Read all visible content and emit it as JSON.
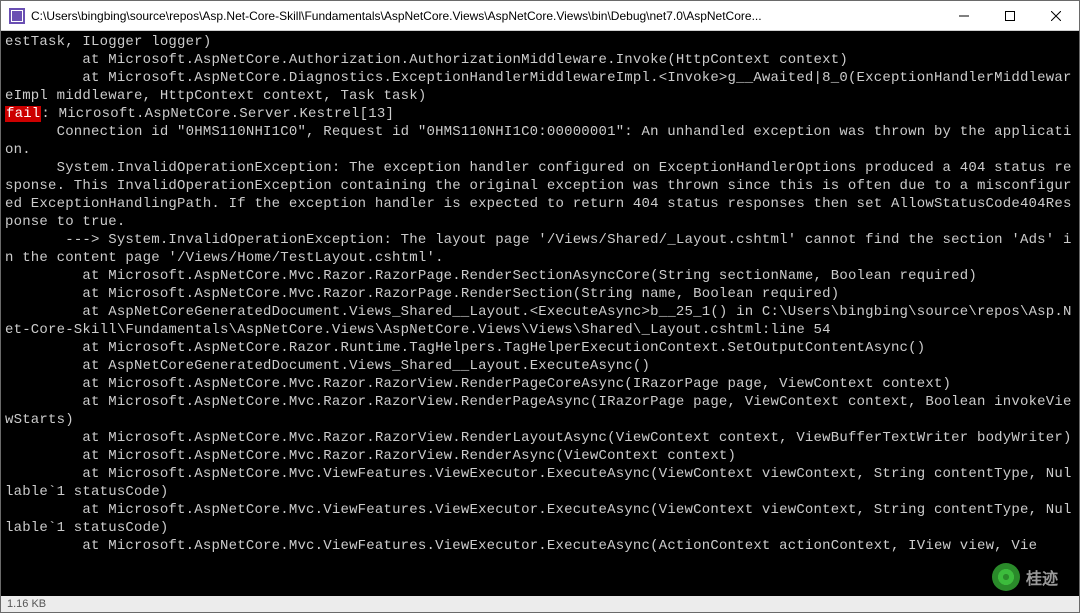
{
  "window": {
    "title": "C:\\Users\\bingbing\\source\\repos\\Asp.Net-Core-Skill\\Fundamentals\\AspNetCore.Views\\AspNetCore.Views\\bin\\Debug\\net7.0\\AspNetCore..."
  },
  "console": {
    "lines": [
      "estTask, ILogger logger)",
      "         at Microsoft.AspNetCore.Authorization.AuthorizationMiddleware.Invoke(HttpContext context)",
      "         at Microsoft.AspNetCore.Diagnostics.ExceptionHandlerMiddlewareImpl.<Invoke>g__Awaited|8_0(ExceptionHandlerMiddlewareImpl middleware, HttpContext context, Task task)"
    ],
    "fail_prefix": "fail",
    "fail_line": ": Microsoft.AspNetCore.Server.Kestrel[13]",
    "lines2": [
      "      Connection id \"0HMS110NHI1C0\", Request id \"0HMS110NHI1C0:00000001\": An unhandled exception was thrown by the application.",
      "      System.InvalidOperationException: The exception handler configured on ExceptionHandlerOptions produced a 404 status response. This InvalidOperationException containing the original exception was thrown since this is often due to a misconfigured ExceptionHandlingPath. If the exception handler is expected to return 404 status responses then set AllowStatusCode404Response to true.",
      "       ---> System.InvalidOperationException: The layout page '/Views/Shared/_Layout.cshtml' cannot find the section 'Ads' in the content page '/Views/Home/TestLayout.cshtml'.",
      "         at Microsoft.AspNetCore.Mvc.Razor.RazorPage.RenderSectionAsyncCore(String sectionName, Boolean required)",
      "         at Microsoft.AspNetCore.Mvc.Razor.RazorPage.RenderSection(String name, Boolean required)",
      "         at AspNetCoreGeneratedDocument.Views_Shared__Layout.<ExecuteAsync>b__25_1() in C:\\Users\\bingbing\\source\\repos\\Asp.Net-Core-Skill\\Fundamentals\\AspNetCore.Views\\AspNetCore.Views\\Views\\Shared\\_Layout.cshtml:line 54",
      "         at Microsoft.AspNetCore.Razor.Runtime.TagHelpers.TagHelperExecutionContext.SetOutputContentAsync()",
      "         at AspNetCoreGeneratedDocument.Views_Shared__Layout.ExecuteAsync()",
      "         at Microsoft.AspNetCore.Mvc.Razor.RazorView.RenderPageCoreAsync(IRazorPage page, ViewContext context)",
      "         at Microsoft.AspNetCore.Mvc.Razor.RazorView.RenderPageAsync(IRazorPage page, ViewContext context, Boolean invokeViewStarts)",
      "         at Microsoft.AspNetCore.Mvc.Razor.RazorView.RenderLayoutAsync(ViewContext context, ViewBufferTextWriter bodyWriter)",
      "         at Microsoft.AspNetCore.Mvc.Razor.RazorView.RenderAsync(ViewContext context)",
      "         at Microsoft.AspNetCore.Mvc.ViewFeatures.ViewExecutor.ExecuteAsync(ViewContext viewContext, String contentType, Nullable`1 statusCode)",
      "         at Microsoft.AspNetCore.Mvc.ViewFeatures.ViewExecutor.ExecuteAsync(ViewContext viewContext, String contentType, Nullable`1 statusCode)",
      "         at Microsoft.AspNetCore.Mvc.ViewFeatures.ViewExecutor.ExecuteAsync(ActionContext actionContext, IView view, Vie"
    ]
  },
  "footer": {
    "size": "1.16 KB"
  },
  "watermark": {
    "text": "桂迹"
  }
}
